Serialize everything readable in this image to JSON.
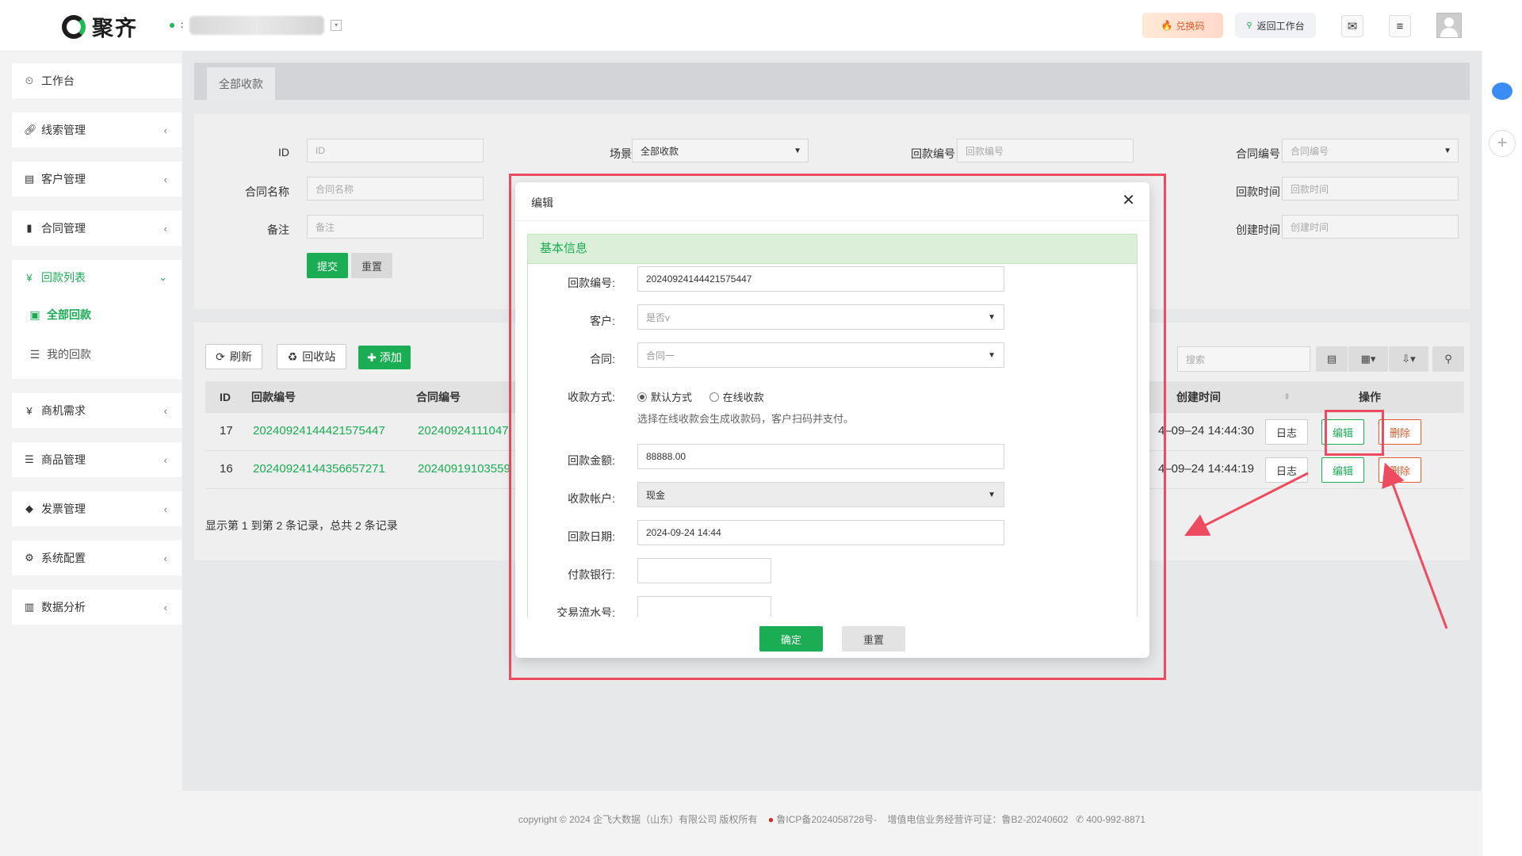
{
  "header": {
    "logo_text": "聚齐",
    "tenant_initial": "∶",
    "redeem_label": "兑换码",
    "return_label": "返回工作台"
  },
  "sidebar": {
    "items": [
      {
        "label": "工作台",
        "icon": "dashboard-icon"
      },
      {
        "label": "线索管理",
        "icon": "link-icon"
      },
      {
        "label": "客户管理",
        "icon": "id-card-icon"
      },
      {
        "label": "合同管理",
        "icon": "bookmark-icon"
      },
      {
        "label": "回款列表",
        "icon": "yen-icon",
        "active": true,
        "children": [
          {
            "label": "全部回款",
            "icon": "money-icon",
            "active": true
          },
          {
            "label": "我的回款",
            "icon": "list-icon"
          }
        ]
      },
      {
        "label": "商机需求",
        "icon": "yen-icon"
      },
      {
        "label": "商品管理",
        "icon": "list-icon"
      },
      {
        "label": "发票管理",
        "icon": "tag-icon"
      },
      {
        "label": "系统配置",
        "icon": "gears-icon"
      },
      {
        "label": "数据分析",
        "icon": "bar-chart-icon"
      }
    ]
  },
  "tabs": {
    "active": "全部收款"
  },
  "filters": {
    "id_label": "ID",
    "id_placeholder": "ID",
    "scene_label": "场景",
    "scene_value": "全部收款",
    "receipt_no_label": "回款编号",
    "receipt_no_placeholder": "回款编号",
    "contract_no_label": "合同编号",
    "contract_no_placeholder": "合同编号",
    "contract_name_label": "合同名称",
    "contract_name_placeholder": "合同名称",
    "receipt_time_label": "回款时间",
    "receipt_time_placeholder": "回款时间",
    "remark_label": "备注",
    "remark_placeholder": "备注",
    "created_time_label": "创建时间",
    "created_time_placeholder": "创建时间",
    "submit_label": "提交",
    "reset_label": "重置"
  },
  "toolbar": {
    "refresh_label": "刷新",
    "recycle_label": "回收站",
    "add_label": "添加",
    "search_placeholder": "搜索"
  },
  "table": {
    "columns": {
      "id": "ID",
      "receipt_no": "回款编号",
      "contract_no": "合同编号",
      "created": "创建时间",
      "ops": "操作"
    },
    "rows": [
      {
        "id": "17",
        "receipt_no": "20240924144421575447",
        "contract_no": "20240924111047",
        "created": "4–09–24 14:44:30"
      },
      {
        "id": "16",
        "receipt_no": "20240924144356657271",
        "contract_no": "20240919103559",
        "created": "4–09–24 14:44:19"
      }
    ],
    "op_log": "日志",
    "op_edit": "编辑",
    "op_delete": "删除",
    "summary": "显示第 1 到第 2 条记录，总共 2 条记录"
  },
  "modal": {
    "title": "编辑",
    "section": "基本信息",
    "receipt_no_label": "回款编号:",
    "receipt_no_value": "20240924144421575447",
    "customer_label": "客户:",
    "customer_value": "是否v",
    "contract_label": "合同:",
    "contract_value": "合同一",
    "method_label": "收款方式:",
    "method_default": "默认方式",
    "method_online": "在线收款",
    "method_hint": "选择在线收款会生成收款码，客户扫码并支付。",
    "amount_label": "回款金额:",
    "amount_value": "88888.00",
    "account_label": "收款帐户:",
    "account_value": "现金",
    "date_label": "回款日期:",
    "date_value": "2024-09-24 14:44",
    "bank_label": "付款银行:",
    "bank_value": "",
    "txn_label": "交易流水号:",
    "txn_value": "",
    "ok_label": "确定",
    "reset_label": "重置"
  },
  "footer": {
    "copyright": "copyright © 2024 企飞大数据（山东）有限公司 版权所有",
    "icp": "鲁ICP备2024058728号-",
    "license": "增值电信业务经营许可证：鲁B2-20240602",
    "phone": "400-992-8871"
  },
  "colors": {
    "accent": "#1aad53",
    "danger": "#e85a2a",
    "annotation": "#ee4b60"
  }
}
